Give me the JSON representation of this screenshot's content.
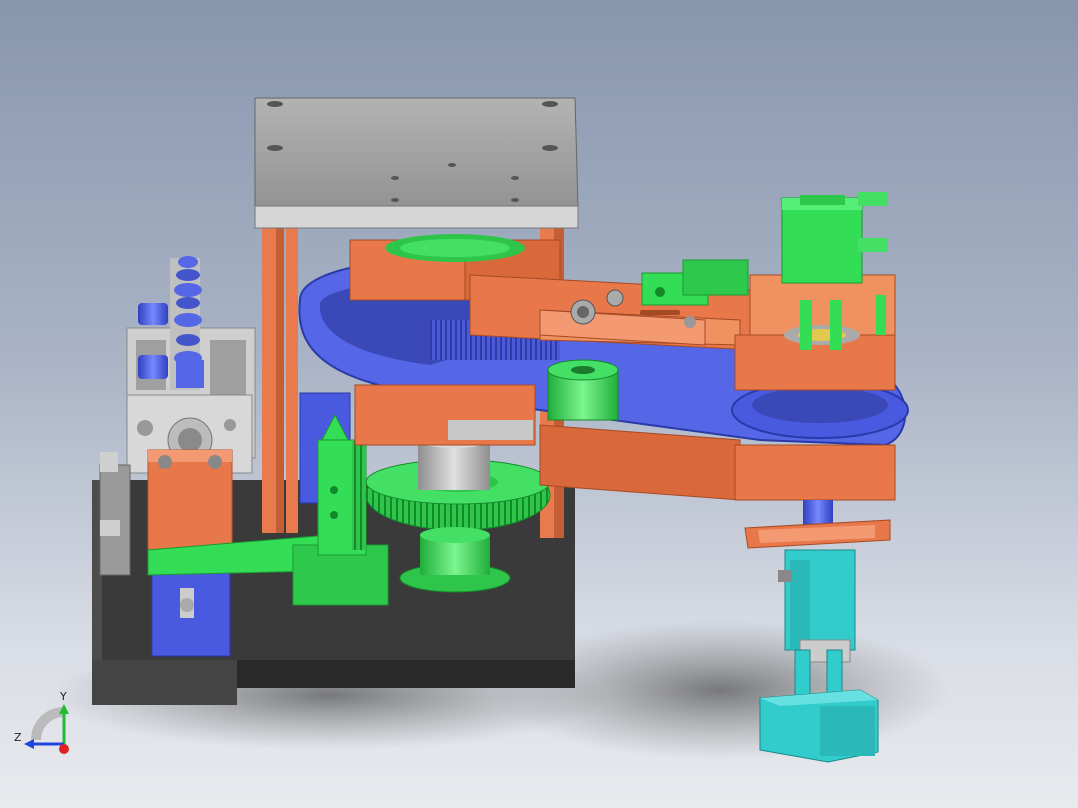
{
  "viewport": {
    "background_top": "#8896ad",
    "background_bottom": "#e8eaee"
  },
  "colors": {
    "orange": "#e8784a",
    "blue": "#5566e6",
    "green": "#33dd55",
    "gray": "#9c9c9c",
    "dark": "#3c3c3c",
    "cyan": "#33cccc",
    "light_gray": "#c8c8c8"
  },
  "triad": {
    "y_label": "Y",
    "z_label": "Z"
  }
}
